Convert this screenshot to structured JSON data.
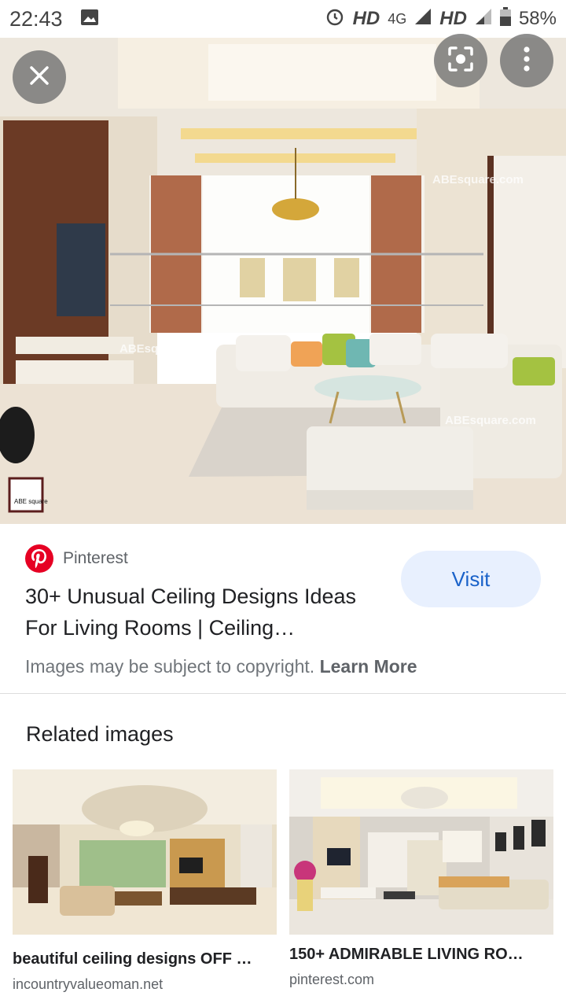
{
  "status_bar": {
    "time": "22:43",
    "network1": "HD",
    "network_type": "4G",
    "network2": "HD",
    "battery": "58%"
  },
  "hero": {
    "watermarks": [
      "ABEsquare.com",
      "ABEsquare",
      "ABEsquare.com"
    ],
    "logo_text": "ABE square"
  },
  "result": {
    "source": "Pinterest",
    "title": "30+ Unusual Ceiling Designs Ideas For Living Rooms | Ceiling…",
    "visit_label": "Visit",
    "copyright_text": "Images may be subject to copyright.",
    "learn_more": "Learn More"
  },
  "related": {
    "heading": "Related images",
    "items": [
      {
        "title": "beautiful ceiling designs OFF …",
        "source": "incountryvalueoman.net"
      },
      {
        "title": "150+ ADMIRABLE LIVING RO…",
        "source": "pinterest.com"
      }
    ]
  },
  "icons": {
    "close": "close-icon",
    "lens": "lens-icon",
    "menu": "more-vert-icon",
    "pinterest": "pinterest-icon"
  }
}
